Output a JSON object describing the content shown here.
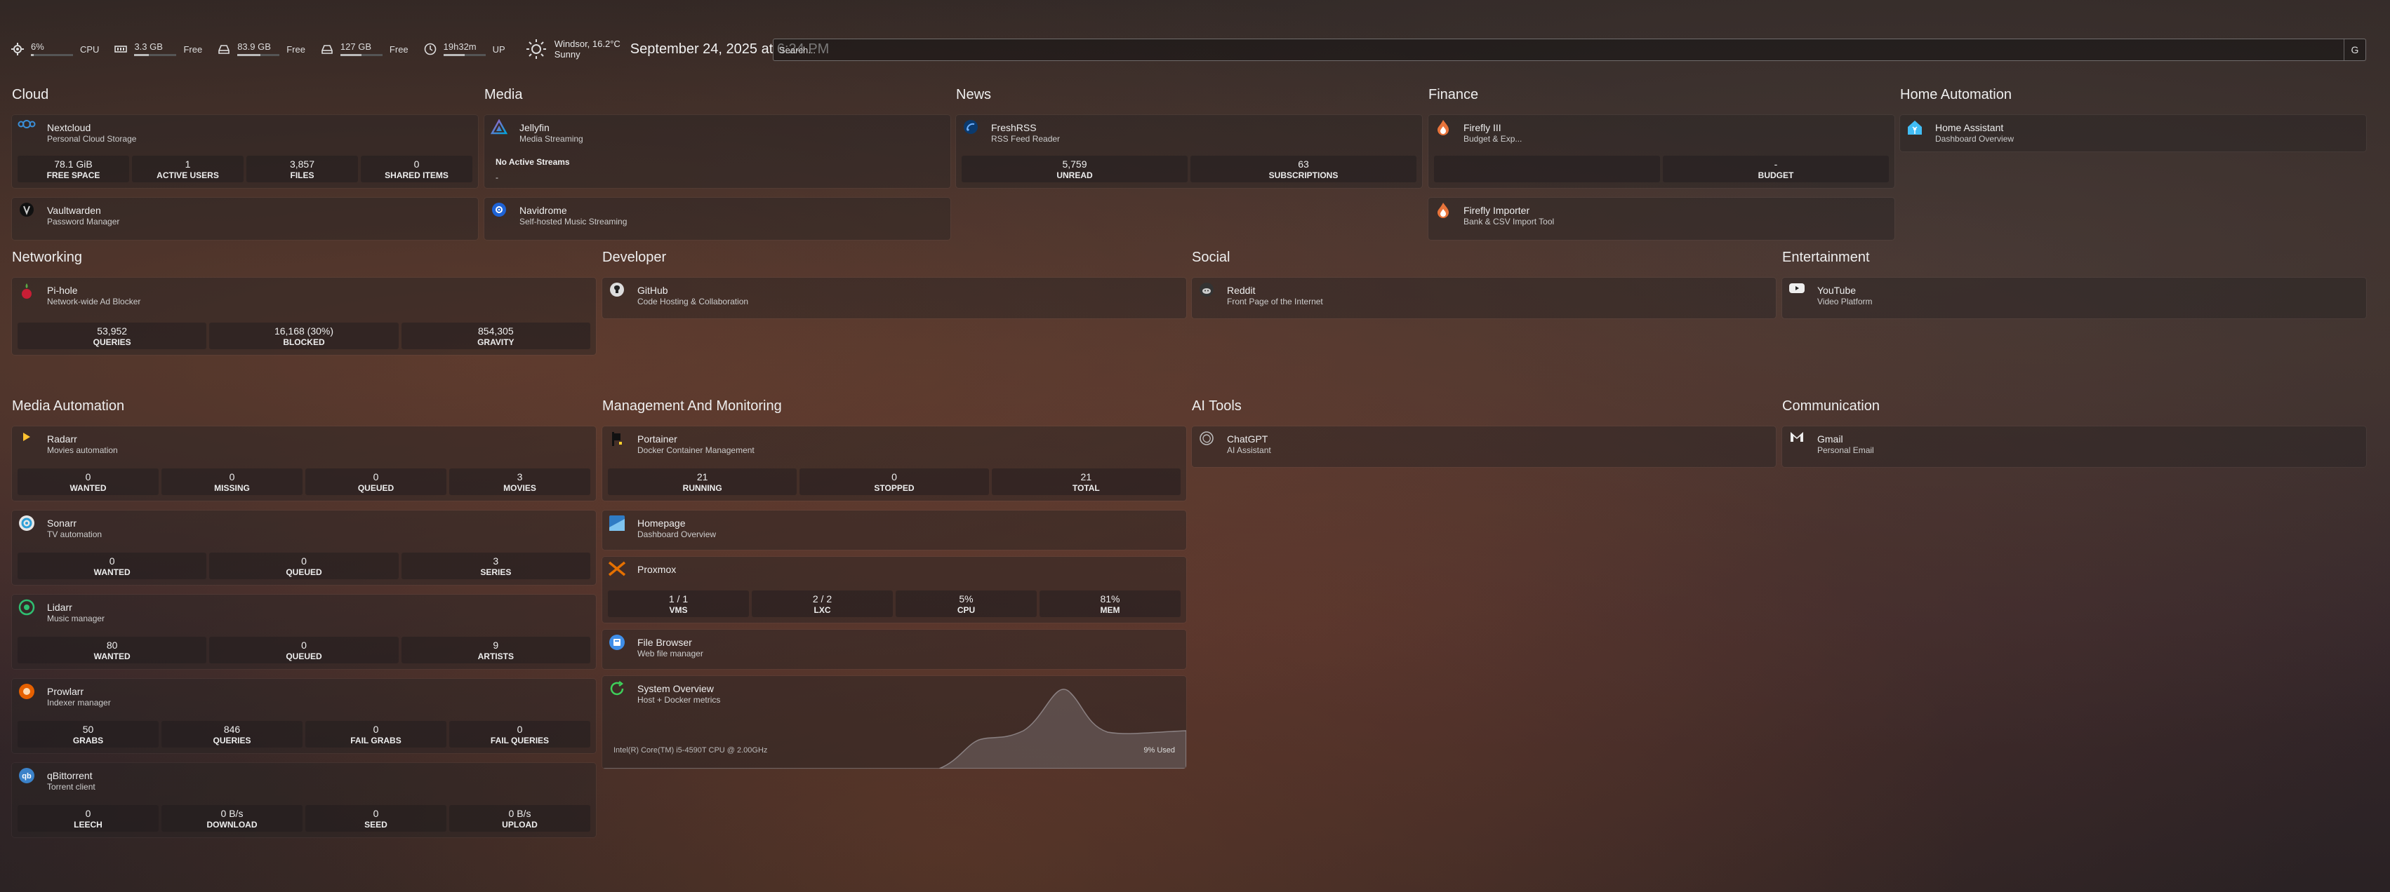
{
  "resources": {
    "cpu": {
      "value": "6%",
      "label": "CPU",
      "level": 0.06
    },
    "memory": {
      "value": "3.3 GB",
      "label": "Free",
      "level": 0.35
    },
    "disk1": {
      "value": "83.9 GB",
      "label": "Free",
      "level": 0.55
    },
    "disk2": {
      "value": "127 GB",
      "label": "Free",
      "level": 0.5
    },
    "uptime": {
      "value": "19h32m",
      "label": "UP",
      "level": 0.5
    }
  },
  "weather": {
    "location": "Windsor, 16.2°C",
    "condition": "Sunny"
  },
  "datetime": "September 24, 2025 at 6:24 PM",
  "search": {
    "placeholder": "Search...",
    "provider": "G"
  },
  "groups": {
    "cloud": "Cloud",
    "media": "Media",
    "news": "News",
    "finance": "Finance",
    "home_automation": "Home Automation",
    "networking": "Networking",
    "developer": "Developer",
    "social": "Social",
    "entertainment": "Entertainment",
    "media_automation": "Media Automation",
    "management": "Management And Monitoring",
    "ai_tools": "AI Tools",
    "communication": "Communication"
  },
  "services": {
    "nextcloud": {
      "name": "Nextcloud",
      "desc": "Personal Cloud Storage",
      "stats": [
        [
          "78.1 GiB",
          "FREE SPACE"
        ],
        [
          "1",
          "ACTIVE USERS"
        ],
        [
          "3,857",
          "FILES"
        ],
        [
          "0",
          "SHARED ITEMS"
        ]
      ]
    },
    "vaultwarden": {
      "name": "Vaultwarden",
      "desc": "Password Manager"
    },
    "jellyfin": {
      "name": "Jellyfin",
      "desc": "Media Streaming",
      "streams_title": "No Active Streams",
      "streams_value": "-"
    },
    "navidrome": {
      "name": "Navidrome",
      "desc": "Self-hosted Music Streaming"
    },
    "freshrss": {
      "name": "FreshRSS",
      "desc": "RSS Feed Reader",
      "stats": [
        [
          "5,759",
          "UNREAD"
        ],
        [
          "63",
          "SUBSCRIPTIONS"
        ]
      ]
    },
    "firefly": {
      "name": "Firefly III",
      "desc": "Budget & Exp...",
      "stats": [
        [
          "",
          ""
        ],
        [
          "-",
          "BUDGET"
        ]
      ]
    },
    "firefly_importer": {
      "name": "Firefly Importer",
      "desc": "Bank & CSV Import Tool"
    },
    "home_assistant": {
      "name": "Home Assistant",
      "desc": "Dashboard Overview"
    },
    "pihole": {
      "name": "Pi-hole",
      "desc": "Network-wide Ad Blocker",
      "stats": [
        [
          "53,952",
          "QUERIES"
        ],
        [
          "16,168 (30%)",
          "BLOCKED"
        ],
        [
          "854,305",
          "GRAVITY"
        ]
      ]
    },
    "github": {
      "name": "GitHub",
      "desc": "Code Hosting & Collaboration"
    },
    "reddit": {
      "name": "Reddit",
      "desc": "Front Page of the Internet"
    },
    "youtube": {
      "name": "YouTube",
      "desc": "Video Platform"
    },
    "radarr": {
      "name": "Radarr",
      "desc": "Movies automation",
      "stats": [
        [
          "0",
          "WANTED"
        ],
        [
          "0",
          "MISSING"
        ],
        [
          "0",
          "QUEUED"
        ],
        [
          "3",
          "MOVIES"
        ]
      ]
    },
    "sonarr": {
      "name": "Sonarr",
      "desc": "TV automation",
      "stats": [
        [
          "0",
          "WANTED"
        ],
        [
          "0",
          "QUEUED"
        ],
        [
          "3",
          "SERIES"
        ]
      ]
    },
    "lidarr": {
      "name": "Lidarr",
      "desc": "Music manager",
      "stats": [
        [
          "80",
          "WANTED"
        ],
        [
          "0",
          "QUEUED"
        ],
        [
          "9",
          "ARTISTS"
        ]
      ]
    },
    "prowlarr": {
      "name": "Prowlarr",
      "desc": "Indexer manager",
      "stats": [
        [
          "50",
          "GRABS"
        ],
        [
          "846",
          "QUERIES"
        ],
        [
          "0",
          "FAIL GRABS"
        ],
        [
          "0",
          "FAIL QUERIES"
        ]
      ]
    },
    "qbittorrent": {
      "name": "qBittorrent",
      "desc": "Torrent client",
      "stats": [
        [
          "0",
          "LEECH"
        ],
        [
          "0 B/s",
          "DOWNLOAD"
        ],
        [
          "0",
          "SEED"
        ],
        [
          "0 B/s",
          "UPLOAD"
        ]
      ]
    },
    "portainer": {
      "name": "Portainer",
      "desc": "Docker Container Management",
      "stats": [
        [
          "21",
          "RUNNING"
        ],
        [
          "0",
          "STOPPED"
        ],
        [
          "21",
          "TOTAL"
        ]
      ]
    },
    "homepage": {
      "name": "Homepage",
      "desc": "Dashboard Overview"
    },
    "proxmox": {
      "name": "Proxmox",
      "desc": "",
      "stats": [
        [
          "1 / 1",
          "VMS"
        ],
        [
          "2 / 2",
          "LXC"
        ],
        [
          "5%",
          "CPU"
        ],
        [
          "81%",
          "MEM"
        ]
      ]
    },
    "filebrowser": {
      "name": "File Browser",
      "desc": "Web file manager"
    },
    "system": {
      "name": "System Overview",
      "desc": "Host + Docker metrics",
      "cpu_model": "Intel(R) Core(TM) i5-4590T CPU @ 2.00GHz",
      "usage": "9% Used"
    },
    "chatgpt": {
      "name": "ChatGPT",
      "desc": "AI Assistant"
    },
    "gmail": {
      "name": "Gmail",
      "desc": "Personal Email"
    }
  }
}
